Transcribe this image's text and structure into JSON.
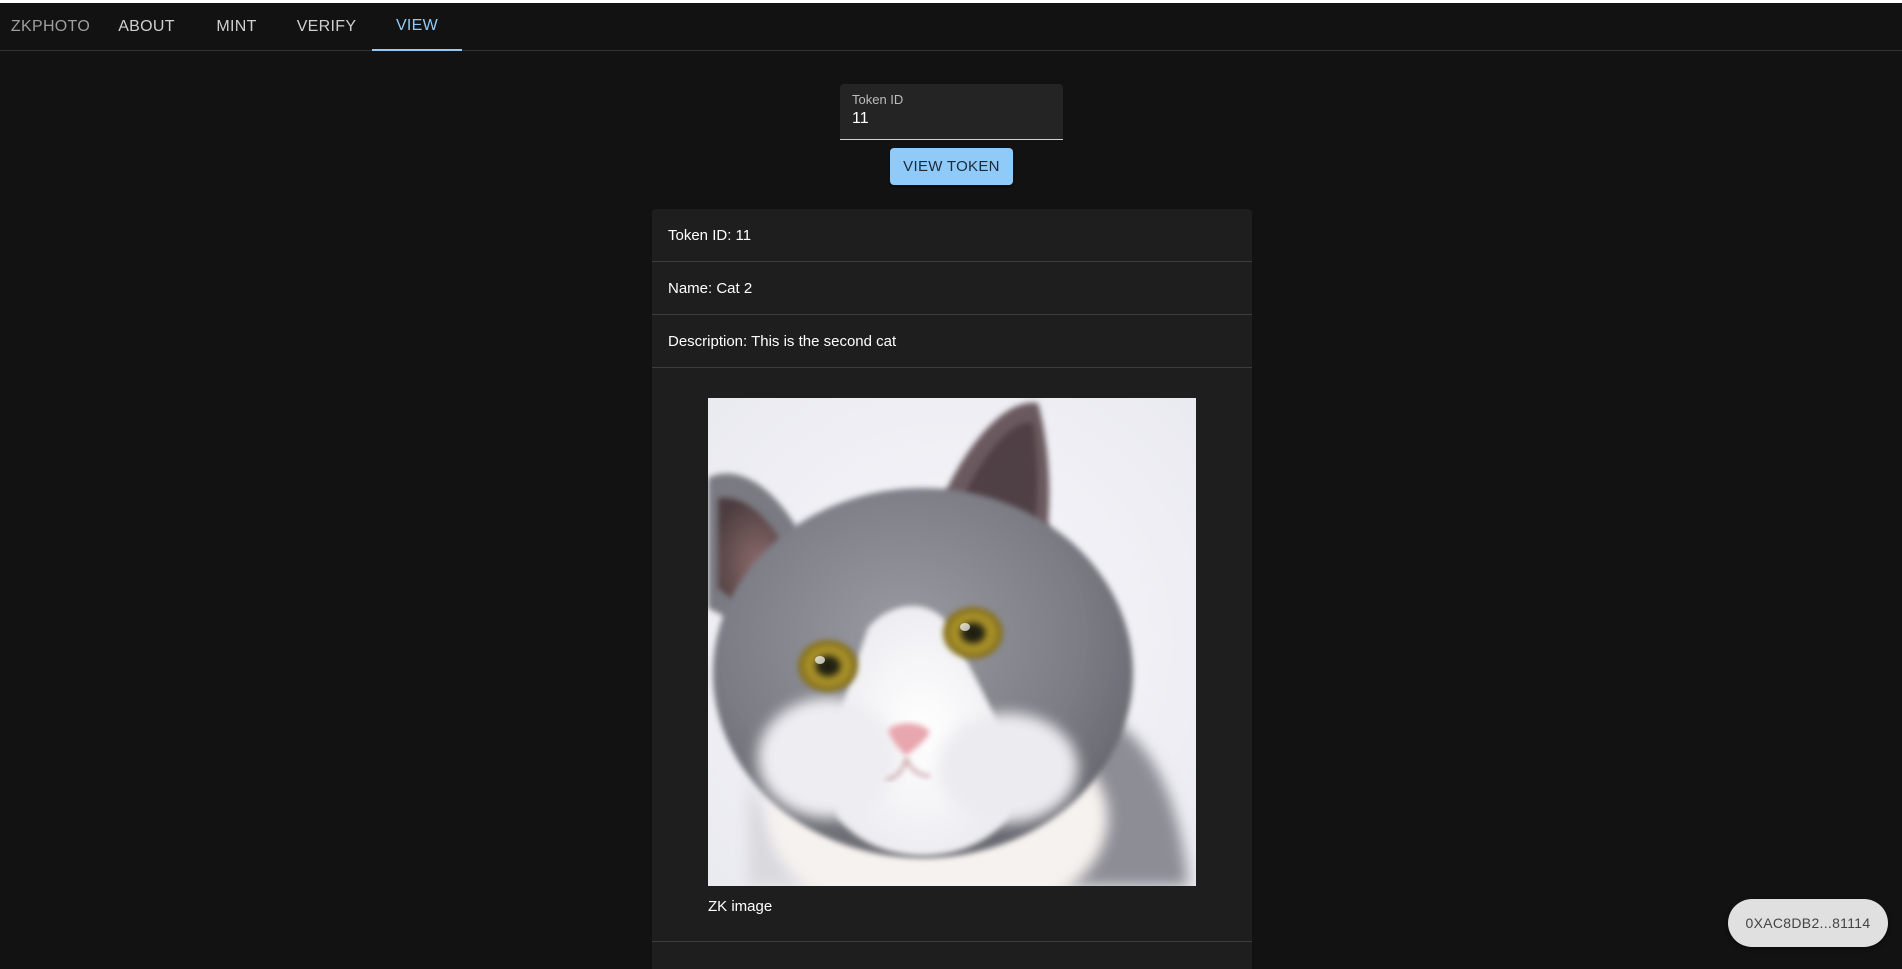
{
  "nav": {
    "brand": "ZKPHOTO",
    "items": [
      {
        "label": "ABOUT"
      },
      {
        "label": "MINT"
      },
      {
        "label": "VERIFY"
      },
      {
        "label": "VIEW"
      }
    ],
    "active": "VIEW"
  },
  "form": {
    "label": "Token ID",
    "value": "11",
    "button": "VIEW TOKEN"
  },
  "token": {
    "id_line": "Token ID: 11",
    "name_line": "Name: Cat 2",
    "description_line": "Description: This is the second cat",
    "image_caption": "ZK image",
    "image_subject": "gray-white-cat-photo"
  },
  "wallet": {
    "address": "0XAC8DB2...81114"
  },
  "colors": {
    "background": "#121212",
    "surface": "#1e1e1e",
    "accent": "#90caf9",
    "text": "#ffffff",
    "muted": "#cfcfcf",
    "chip": "#e0e0e0"
  }
}
